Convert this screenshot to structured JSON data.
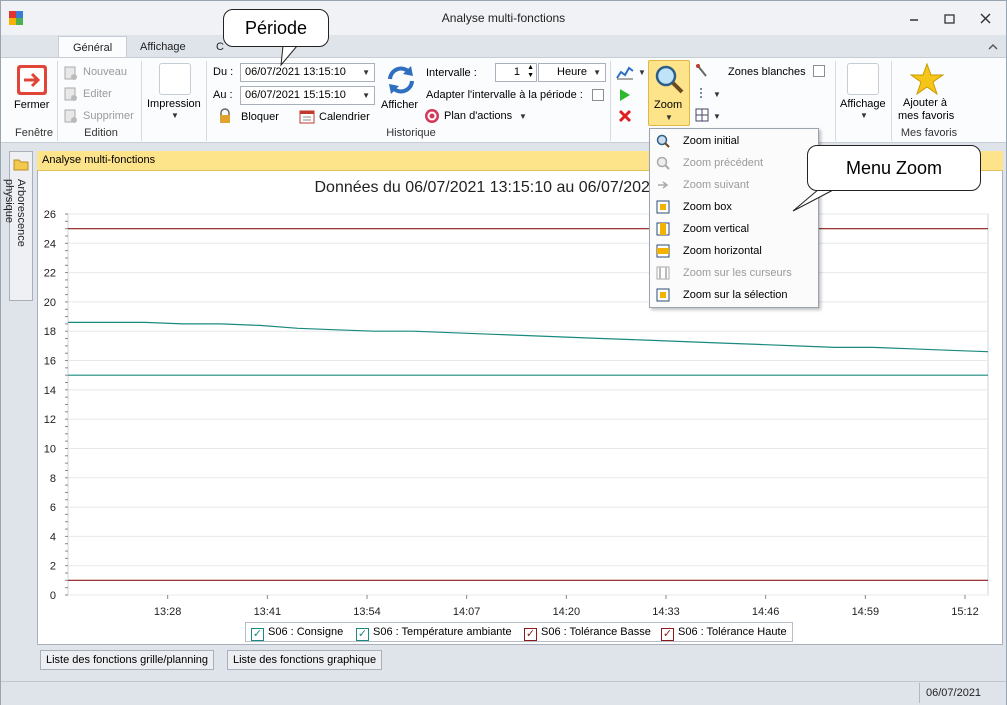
{
  "window": {
    "title": "Analyse multi-fonctions"
  },
  "tabs": [
    {
      "label": "Général"
    },
    {
      "label": "Affichage"
    },
    {
      "label": "C"
    }
  ],
  "ribbon": {
    "fenetre": {
      "close_label": "Fermer",
      "group": "Fenêtre"
    },
    "edition": {
      "new_label": "Nouveau",
      "edit_label": "Editer",
      "delete_label": "Supprimer",
      "group": "Edition"
    },
    "print_label": "Impression",
    "historique": {
      "du_label": "Du :",
      "du_value": "06/07/2021 13:15:10",
      "au_label": "Au :",
      "au_value": "06/07/2021 15:15:10",
      "bloquer_label": "Bloquer",
      "calendrier_label": "Calendrier",
      "afficher_label": "Afficher",
      "intervalle_label": "Intervalle :",
      "intervalle_value": "1",
      "intervalle_unit": "Heure",
      "adapter_label": "Adapter l'intervalle à la période :",
      "plan_label": "Plan d'actions",
      "group": "Historique"
    },
    "zoom_label": "Zoom",
    "zones_label": "Zones blanches",
    "affichage_label": "Affichage",
    "favoris": {
      "add_label_1": "Ajouter à",
      "add_label_2": "mes favoris",
      "group": "Mes favoris"
    }
  },
  "sidebar": {
    "label": "Arborescence physique"
  },
  "document": {
    "tab_label": "Analyse multi-fonctions"
  },
  "chart_data": {
    "type": "line",
    "title": "Données du 06/07/2021 13:15:10 au 06/07/2021 15:15:10",
    "xlabel": "",
    "ylabel": "",
    "ylim": [
      0,
      26
    ],
    "xlim_minutes_of_day": [
      795,
      915
    ],
    "y_ticks": [
      "0",
      "2",
      "4",
      "6",
      "8",
      "10",
      "12",
      "14",
      "16",
      "18",
      "20",
      "22",
      "24",
      "26"
    ],
    "x_ticks": [
      "13:28",
      "13:41",
      "13:54",
      "14:07",
      "14:20",
      "14:33",
      "14:46",
      "14:59",
      "15:12"
    ],
    "grid": true,
    "legend_position": "bottom",
    "series": [
      {
        "name": "S06 : Consigne",
        "color": "#1a8a7f",
        "checked": true,
        "x": [
          "13:15",
          "15:15"
        ],
        "values": [
          15,
          15
        ]
      },
      {
        "name": "S06 : Température ambiante",
        "color": "#1a8a7f",
        "checked": true,
        "x": [
          "13:15",
          "13:20",
          "13:25",
          "13:30",
          "13:35",
          "13:40",
          "13:45",
          "13:50",
          "13:55",
          "14:00",
          "14:05",
          "14:10",
          "14:15",
          "14:20",
          "14:25",
          "14:30",
          "14:35",
          "14:40",
          "14:45",
          "14:50",
          "14:55",
          "15:00",
          "15:05",
          "15:10",
          "15:15"
        ],
        "values": [
          18.6,
          18.6,
          18.6,
          18.5,
          18.5,
          18.4,
          18.2,
          18.1,
          18.0,
          18.0,
          17.9,
          17.8,
          17.7,
          17.6,
          17.5,
          17.4,
          17.3,
          17.2,
          17.1,
          17.0,
          16.9,
          16.9,
          16.8,
          16.7,
          16.6
        ]
      },
      {
        "name": "S06 : Tolérance Basse",
        "color": "#8b1a1a",
        "checked": true,
        "x": [
          "13:15",
          "15:15"
        ],
        "values": [
          1,
          1
        ]
      },
      {
        "name": "S06 : Tolérance Haute",
        "color": "#8b1a1a",
        "checked": true,
        "x": [
          "13:15",
          "15:15"
        ],
        "values": [
          25,
          25
        ]
      }
    ]
  },
  "bottom_tabs": [
    {
      "label": "Liste des fonctions grille/planning"
    },
    {
      "label": "Liste des fonctions graphique"
    }
  ],
  "status": {
    "date": "06/07/2021"
  },
  "zoom_menu": {
    "items": [
      {
        "label": "Zoom initial",
        "enabled": true
      },
      {
        "label": "Zoom précédent",
        "enabled": false
      },
      {
        "label": "Zoom suivant",
        "enabled": false
      },
      {
        "label": "Zoom box",
        "enabled": true
      },
      {
        "label": "Zoom vertical",
        "enabled": true
      },
      {
        "label": "Zoom horizontal",
        "enabled": true
      },
      {
        "label": "Zoom sur les curseurs",
        "enabled": false
      },
      {
        "label": "Zoom sur la sélection",
        "enabled": true
      }
    ]
  },
  "callouts": {
    "periode": "Période",
    "menu_zoom": "Menu Zoom"
  },
  "colors": {
    "accent": "#fde38a",
    "close_red": "#e0453a"
  }
}
